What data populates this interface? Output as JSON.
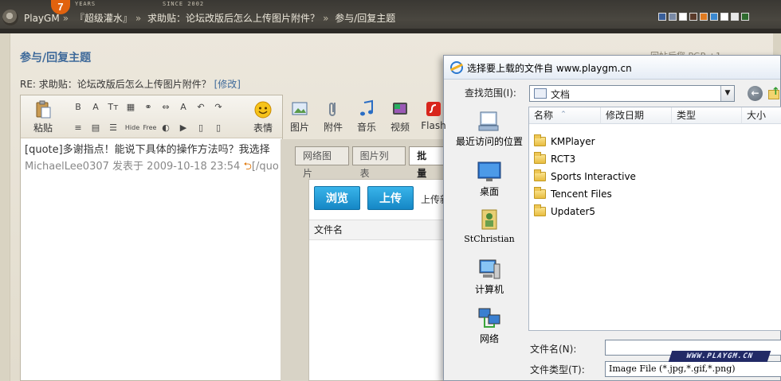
{
  "header": {
    "site_name": "PlayGM",
    "badge": "7",
    "tiny_left": "YEARS",
    "tiny_right": "SINCE 2002",
    "breadcrumb": [
      {
        "label": "PlayGM",
        "sep": "»"
      },
      {
        "label": "『超级灌水』",
        "sep": "»"
      },
      {
        "label": "求助贴：论坛改版后怎么上传图片附件？",
        "sep": "»"
      },
      {
        "label": "参与/回复主题",
        "sep": ""
      }
    ],
    "swatch_colors": [
      "#3a5f9a",
      "#7a8aa6",
      "#ffffff",
      "#5a3a2a",
      "#e07a20",
      "#3a88d0",
      "#ffffff",
      "#e8e8e8",
      "#2e6a2e"
    ]
  },
  "page": {
    "title": "参与/回复主题",
    "right_hint": "回帖后您 PGP +1",
    "subject_prefix": "RE: 求助贴：论坛改版后怎么上传图片附件？",
    "subject_edit": "[修改]"
  },
  "editor": {
    "paste_label": "粘贴",
    "tools": [
      {
        "name": "emoticon",
        "label": "表情"
      },
      {
        "name": "image",
        "label": "图片"
      },
      {
        "name": "attachment",
        "label": "附件"
      },
      {
        "name": "music",
        "label": "音乐"
      },
      {
        "name": "video",
        "label": "视频"
      },
      {
        "name": "flash",
        "label": "Flash"
      }
    ],
    "mini_row1": [
      "B",
      "A",
      "Tт",
      "▦",
      "⚭",
      "⇔",
      "A",
      "↶",
      "↷"
    ],
    "mini_row2": [
      "≡",
      "▤",
      "☰",
      "Hide",
      "Free",
      "◐",
      "▶",
      "▯",
      "▯"
    ],
    "quote_line": "[quote]多谢指点！能说下具体的操作方法吗？我选择",
    "meta_user": "MichaelLee0307 发表于",
    "meta_date": "2009-10-18 23:54",
    "meta_tail": "[/quote]"
  },
  "upload": {
    "tabs": [
      "网络图片",
      "图片列表",
      "批量"
    ],
    "browse_label": "浏览",
    "upload_label": "上传",
    "hint": "上传新",
    "file_col": "文件名"
  },
  "dialog": {
    "title": "选择要上载的文件自 www.playgm.cn",
    "lookin_label": "查找范围(I):",
    "lookin_value": "文档",
    "places": [
      {
        "label": "最近访问的位置"
      },
      {
        "label": "桌面"
      },
      {
        "label": "StChristian"
      },
      {
        "label": "计算机"
      },
      {
        "label": "网络"
      }
    ],
    "columns": [
      "名称",
      "修改日期",
      "类型",
      "大小"
    ],
    "files": [
      "KMPlayer",
      "RCT3",
      "Sports Interactive",
      "Tencent Files",
      "Updater5"
    ],
    "filename_label": "文件名(N):",
    "filename_value": "",
    "filetype_label": "文件类型(T):",
    "filetype_value": "Image File (*.jpg,*.gif,*.png)"
  },
  "watermark": "WWW.PLAYGM.CN"
}
